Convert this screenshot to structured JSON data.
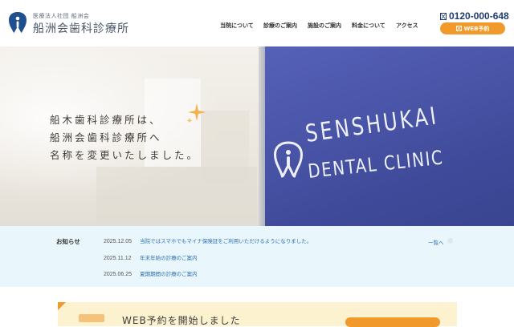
{
  "header": {
    "corp_name": "医療法人社団 船洲会",
    "clinic_name": "船洲会歯科診療所",
    "nav": [
      {
        "label": "当院について"
      },
      {
        "label": "診療のご案内"
      },
      {
        "label": "施設のご案内"
      },
      {
        "label": "料金について"
      },
      {
        "label": "アクセス"
      }
    ],
    "phone": "0120-000-648",
    "web_button": "WEB予約"
  },
  "hero": {
    "lines": [
      "船木歯科診療所は、",
      "船洲会歯科診療所へ",
      "名称を変更いたしました。"
    ],
    "sign_line1": "SENSHUKAI",
    "sign_line2": "DENTAL CLINIC"
  },
  "news": {
    "title": "お知らせ",
    "more_label": "一覧へ",
    "items": [
      {
        "date": "2025.12.05",
        "text": "当院ではスマホでもマイナ保険証をご利用いただけるようになりました。"
      },
      {
        "date": "2025.11.12",
        "text": "年末年始の診療のご案内"
      },
      {
        "date": "2025.06.25",
        "text": "夏期期間の診療のご案内"
      }
    ]
  },
  "banner": {
    "title": "WEB予約を開始しました"
  },
  "colors": {
    "accent": "#f19a2b",
    "brand": "#1f3b72",
    "link": "#2a6fb3",
    "news_bg": "#e9f6fb"
  },
  "icons": {
    "logo": "tooth-logo-icon",
    "phone": "phone-icon",
    "calendar": "calendar-icon",
    "sparkle": "sparkle-icon"
  }
}
